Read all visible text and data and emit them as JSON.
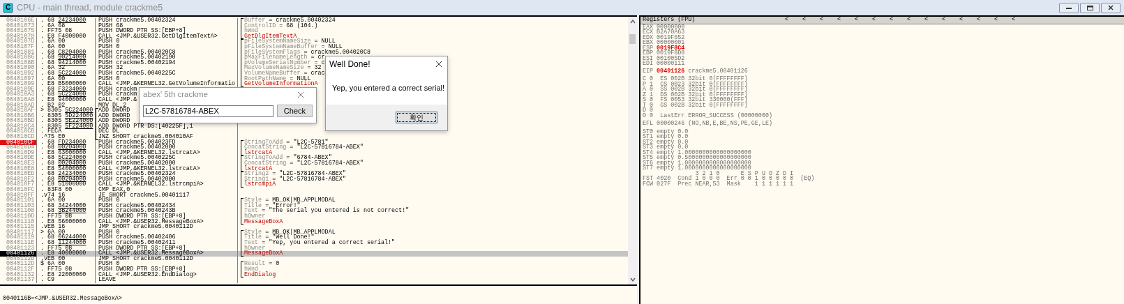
{
  "window": {
    "icon_letter": "C",
    "title": "CPU - main thread, module crackme5"
  },
  "disasm": {
    "rows": [
      {
        "address": "0040106E",
        "hex": ". 68",
        "ref": "24234000",
        "asm": "PUSH crackme5.00402324",
        "comment": {
          "kind": "arg",
          "name": "Buffer",
          "value": "= crackme5.00402324"
        },
        "selected": false,
        "breakpoint": false
      },
      {
        "address": "00401073",
        "hex": ". 6A 68",
        "asm": "PUSH 68",
        "comment": {
          "kind": "arg",
          "name": "ControlID",
          "value": "= 68 (104.)"
        },
        "selected": false,
        "breakpoint": false
      },
      {
        "address": "00401075",
        "hex": ". FF75 08",
        "asm": "PUSH DWORD PTR SS:[EBP+8]",
        "comment": {
          "kind": "arg",
          "name": "hWnd"
        },
        "selected": false,
        "breakpoint": false
      },
      {
        "address": "00401078",
        "hex": ". E8 F4000000",
        "asm": "CALL <JMP.&USER32.GetDlgItemTextA>",
        "comment": {
          "kind": "call",
          "name": "GetDlgItemTextA"
        },
        "selected": false,
        "breakpoint": false
      },
      {
        "address": "0040107D",
        "hex": ". 6A 00",
        "asm": "PUSH 0",
        "comment": {
          "kind": "arg",
          "name": "pFileSystemNameSize",
          "value": "= NULL"
        },
        "selected": false,
        "breakpoint": false
      },
      {
        "address": "0040107F",
        "hex": ". 6A 00",
        "asm": "PUSH 0",
        "comment": {
          "kind": "arg",
          "name": "pFileSystemNameBuffer",
          "value": "= NULL"
        },
        "selected": false,
        "breakpoint": false
      },
      {
        "address": "00401081",
        "hex": ". 68",
        "ref": "C8204000",
        "asm": "PUSH crackme5.004020C8",
        "comment": {
          "kind": "arg",
          "name": "pFileSystemFlags",
          "value": "= crackme5.004020C8"
        },
        "selected": false,
        "breakpoint": false
      },
      {
        "address": "00401086",
        "hex": ". 68",
        "ref": "90214000",
        "asm": "PUSH crackme5.00402190",
        "comment": {
          "kind": "arg",
          "name": "pMaxFilenameLength",
          "value": "= cr"
        },
        "selected": false,
        "breakpoint": false
      },
      {
        "address": "0040108B",
        "hex": ". 68",
        "ref": "94214000",
        "asm": "PUSH crackme5.00402194",
        "comment": {
          "kind": "arg",
          "name": "pVolumeSerialNumber",
          "value": "= c"
        },
        "selected": false,
        "breakpoint": false
      },
      {
        "address": "00401090",
        "hex": ". 6A 32",
        "asm": "PUSH 32",
        "comment": {
          "kind": "arg",
          "name": "MaxVolumeNameSize",
          "value": "= 32"
        },
        "selected": false,
        "breakpoint": false
      },
      {
        "address": "00401092",
        "hex": ". 68",
        "ref": "5C224000",
        "asm": "PUSH crackme5.0040225C",
        "comment": {
          "kind": "arg",
          "name": "VolumeNameBuffer",
          "value": "= crac"
        },
        "selected": false,
        "breakpoint": false
      },
      {
        "address": "00401097",
        "hex": ". 6A 00",
        "asm": "PUSH 0",
        "comment": {
          "kind": "arg",
          "name": "RootPathName",
          "value": "= NULL"
        },
        "selected": false,
        "breakpoint": false
      },
      {
        "address": "00401099",
        "hex": ". E8 B5000000",
        "asm": "CALL <JMP.&KERNEL32.GetVolumeInformatio",
        "comment": {
          "kind": "call",
          "name": "GetVolumeInformationA"
        },
        "selected": false,
        "breakpoint": false
      },
      {
        "address": "0040109E",
        "hex": ". 68",
        "ref": "F3234000",
        "asm": "PUSH crackm",
        "selected": false,
        "breakpoint": false
      },
      {
        "address": "004010A3",
        "hex": ". 68",
        "ref": "5C224000",
        "asm": "PUSH crackm",
        "selected": false,
        "breakpoint": false
      },
      {
        "address": "004010A8",
        "hex": ". E8 94000000",
        "asm": "CALL <JMP.&",
        "selected": false,
        "breakpoint": false
      },
      {
        "address": "004010AD",
        "hex": ". B2 02",
        "asm": "MOV DL,2",
        "selected": false,
        "breakpoint": false
      },
      {
        "address": "004010AF",
        "hex": "> 8305",
        "ref": "5C224000",
        "asm": "ADD DWORD",
        "kind": "loop_start",
        "selected": false,
        "breakpoint": false
      },
      {
        "address": "004010B6",
        "hex": ". 8305",
        "ref": "5D224000",
        "asm": "ADD DWORD",
        "kind": "loop_body",
        "selected": false,
        "breakpoint": false
      },
      {
        "address": "004010BD",
        "hex": ". 8305",
        "ref": "5E224000",
        "asm": "ADD DWORD",
        "kind": "loop_body",
        "selected": false,
        "breakpoint": false
      },
      {
        "address": "004010C4",
        "hex": ". 8305",
        "ref": "5F224000",
        "asm": "ADD DWORD PTR DS:[40225F],1",
        "kind": "loop_body",
        "selected": false,
        "breakpoint": false
      },
      {
        "address": "004010CB",
        "hex": ". FECA",
        "asm": "DEC DL",
        "kind": "loop_body",
        "selected": false,
        "breakpoint": false
      },
      {
        "address": "004010CD",
        "hex": ".^75 E0",
        "asm": "JNZ SHORT crackme5.004010AF",
        "kind": "loop_end",
        "selected": false,
        "breakpoint": false
      },
      {
        "address": "004010CF",
        "hex": ". 68",
        "ref": "FD234000",
        "asm": "PUSH crackme5.004023FD",
        "comment": {
          "kind": "arg",
          "name": "StringToAdd",
          "value": "= \"L2C-5781\""
        },
        "selected": false,
        "breakpoint": true
      },
      {
        "address": "004010D4",
        "hex": ". 68",
        "ref": "00204000",
        "asm": "PUSH crackme5.00402000",
        "comment": {
          "kind": "arg",
          "name": "ConcatString",
          "value": "= \"L2C-57816784-ABEX\""
        },
        "selected": false,
        "breakpoint": false
      },
      {
        "address": "004010D9",
        "hex": ". E8 63000000",
        "asm": "CALL <JMP.&KERNEL32.lstrcatA>",
        "comment": {
          "kind": "call",
          "name": "lstrcatA"
        },
        "selected": false,
        "breakpoint": false
      },
      {
        "address": "004010DE",
        "hex": ". 68",
        "ref": "5C224000",
        "asm": "PUSH crackme5.0040225C",
        "comment": {
          "kind": "arg",
          "name": "StringToAdd",
          "value": "= \"6784-ABEX\""
        },
        "selected": false,
        "breakpoint": false
      },
      {
        "address": "004010E3",
        "hex": ". 68",
        "ref": "00204000",
        "asm": "PUSH crackme5.00402000",
        "comment": {
          "kind": "arg",
          "name": "ConcatString",
          "value": "= \"L2C-57816784-ABEX\""
        },
        "selected": false,
        "breakpoint": false
      },
      {
        "address": "004010E8",
        "hex": ". E8 54000000",
        "asm": "CALL <JMP.&KERNEL32.lstrcatA>",
        "comment": {
          "kind": "call",
          "name": "lstrcatA"
        },
        "selected": false,
        "breakpoint": false
      },
      {
        "address": "004010ED",
        "hex": ". 68",
        "ref": "24234000",
        "asm": "PUSH crackme5.00402324",
        "comment": {
          "kind": "arg",
          "name": "String2",
          "value": "= \"L2C-57816784-ABEX\""
        },
        "selected": false,
        "breakpoint": false
      },
      {
        "address": "004010F2",
        "hex": ". 68",
        "ref": "00204000",
        "asm": "PUSH crackme5.00402000",
        "comment": {
          "kind": "arg",
          "name": "String1",
          "value": "= \"L2C-57816784-ABEX\""
        },
        "selected": false,
        "breakpoint": false
      },
      {
        "address": "004010F7",
        "hex": ". E8 51000000",
        "asm": "CALL <JMP.&KERNEL32.lstrcmpiA>",
        "comment": {
          "kind": "call",
          "name": "lstrcmpiA"
        },
        "selected": false,
        "breakpoint": false
      },
      {
        "address": "004010FC",
        "hex": ". 83F8 00",
        "asm": "CMP EAX,0",
        "selected": false,
        "breakpoint": false
      },
      {
        "address": "004010FF",
        "hex": ".v74 16",
        "asm": "JE SHORT crackme5.00401117",
        "selected": false,
        "breakpoint": false
      },
      {
        "address": "00401101",
        "hex": ". 6A 00",
        "asm": "PUSH 0",
        "comment": {
          "kind": "arg",
          "name": "Style",
          "value": "= MB_OK|MB_APPLMODAL"
        },
        "selected": false,
        "breakpoint": false
      },
      {
        "address": "00401103",
        "hex": ". 68",
        "ref": "34244000",
        "asm": "PUSH crackme5.00402434",
        "comment": {
          "kind": "arg",
          "name": "Title",
          "value": "= \"Error!\""
        },
        "selected": false,
        "breakpoint": false
      },
      {
        "address": "00401108",
        "hex": ". 68",
        "ref": "3B244000",
        "asm": "PUSH crackme5.0040243B",
        "comment": {
          "kind": "arg",
          "name": "Text",
          "value": "= \"The serial you entered is not correct!\""
        },
        "selected": false,
        "breakpoint": false
      },
      {
        "address": "0040110D",
        "hex": ". FF75 08",
        "asm": "PUSH DWORD PTR SS:[EBP+8]",
        "comment": {
          "kind": "arg",
          "name": "hOwner"
        },
        "selected": false,
        "breakpoint": false
      },
      {
        "address": "00401110",
        "hex": ". E8 56000000",
        "asm": "CALL <JMP.&USER32.MessageBoxA>",
        "comment": {
          "kind": "call",
          "name": "MessageBoxA"
        },
        "selected": false,
        "breakpoint": false
      },
      {
        "address": "00401115",
        "hex": ".vEB 16",
        "asm": "JMP SHORT crackme5.0040112D",
        "selected": false,
        "breakpoint": false
      },
      {
        "address": "00401117",
        "hex": "> 6A 00",
        "asm": "PUSH 0",
        "comment": {
          "kind": "arg",
          "name": "Style",
          "value": "= MB_OK|MB_APPLMODAL"
        },
        "selected": false,
        "breakpoint": false
      },
      {
        "address": "00401119",
        "hex": ". 68",
        "ref": "06244000",
        "asm": "PUSH crackme5.00402406",
        "comment": {
          "kind": "arg",
          "name": "Title",
          "value": "= \"Well Done!\""
        },
        "selected": false,
        "breakpoint": false
      },
      {
        "address": "0040111E",
        "hex": ". 68",
        "ref": "11244000",
        "asm": "PUSH crackme5.00402411",
        "comment": {
          "kind": "arg",
          "name": "Text",
          "value": "= \"Yep, you entered a correct serial!\""
        },
        "selected": false,
        "breakpoint": false
      },
      {
        "address": "00401123",
        "hex": ". FF75 08",
        "asm": "PUSH DWORD PTR SS:[EBP+8]",
        "comment": {
          "kind": "arg",
          "name": "hOwner"
        },
        "selected": false,
        "breakpoint": false
      },
      {
        "address": "00401126",
        "hex": ". E8 40000000",
        "asm": "CALL <JMP.&USER32.MessageBoxA>",
        "comment": {
          "kind": "call",
          "name": "MessageBoxA"
        },
        "selected": true,
        "breakpoint": false
      },
      {
        "address": "0040112B",
        "hex": ".vEB 00",
        "asm": "JMP SHORT crackme5.0040112D",
        "selected": false,
        "breakpoint": false
      },
      {
        "address": "0040112D",
        "hex": "$ 6A 00",
        "asm": "PUSH 0",
        "comment": {
          "kind": "arg",
          "name": "Result",
          "value": "= 0"
        },
        "selected": false,
        "breakpoint": false
      },
      {
        "address": "0040112F",
        "hex": ". FF75 08",
        "asm": "PUSH DWORD PTR SS:[EBP+8]",
        "comment": {
          "kind": "arg",
          "name": "hWnd"
        },
        "selected": false,
        "breakpoint": false
      },
      {
        "address": "00401132",
        "hex": ". E8 22000000",
        "asm": "CALL <JMP.&USER32.EndDialog>",
        "comment": {
          "kind": "call",
          "name": "EndDialog"
        },
        "selected": false,
        "breakpoint": false
      },
      {
        "address": "00401137",
        "hex": ". C9",
        "asm": "LEAVE",
        "selected": false,
        "breakpoint": false
      }
    ]
  },
  "info_line": "0040116B=<JMP.&USER32.MessageBoxA>",
  "input_dialog": {
    "title": "abex' 5th crackme",
    "value": "L2C-57816784-ABEX",
    "button": "Check"
  },
  "message_box": {
    "title": "Well Done!",
    "message": "Yep, you entered a correct serial!",
    "button": "확인"
  },
  "registers": {
    "header": "Registers (FPU)",
    "arrows": [
      "<",
      "<",
      "<",
      "<",
      "<",
      "<",
      "<",
      "<",
      "<",
      "<",
      "<",
      "<",
      "<",
      "<"
    ],
    "general": [
      {
        "name": "EAX",
        "value": "00000000",
        "changed": false
      },
      {
        "name": "ECX",
        "value": "B2A70A63",
        "changed": false
      },
      {
        "name": "EDX",
        "value": "0019F652",
        "changed": false
      },
      {
        "name": "EBX",
        "value": "00000001",
        "changed": false
      },
      {
        "name": "ESP",
        "value": "0019F8C4",
        "changed": true
      },
      {
        "name": "EBP",
        "value": "0019F8D8",
        "changed": false
      },
      {
        "name": "ESI",
        "value": "001005D2",
        "changed": false
      },
      {
        "name": "EDI",
        "value": "00000111",
        "changed": false
      }
    ],
    "eip": {
      "name": "EIP",
      "value": "00401126",
      "changed": true,
      "comment": "crackme5.00401126"
    },
    "flag_lines": [
      "C 0  ES 002B 32bit 0(FFFFFFFF)",
      "P 1  CS 0023 32bit 0(FFFFFFFF)",
      "A 0  SS 002B 32bit 0(FFFFFFFF)",
      "Z 1  DS 002B 32bit 0(FFFFFFFF)",
      "S 0  FS 0053 32bit 330000(FFF)",
      "T 0  GS 002B 32bit 0(FFFFFFFF)",
      "D 0",
      "O 0  LastErr ERROR_SUCCESS (00000000)"
    ],
    "efl": "EFL 00000246 (NO,NB,E,BE,NS,PE,GE,LE)",
    "fpu_lines": [
      "ST0 empty 0.0",
      "ST1 empty 0.0",
      "ST2 empty 0.0",
      "ST3 empty 0.0",
      "ST4 empty 1.0000000000000000000",
      "ST5 empty 0.5000000000000000000",
      "ST6 empty 1.0000000000000000000",
      "ST7 empty 1.0000000000000000000",
      "               3 2 1 0      E S P U O Z D I",
      "FST 4020  Cond 1 0 0 0  Err 0 0 1 0 0 0 0 0  (EQ)",
      "FCW 027F  Prec NEAR,53  Mask    1 1 1 1 1 1"
    ]
  }
}
